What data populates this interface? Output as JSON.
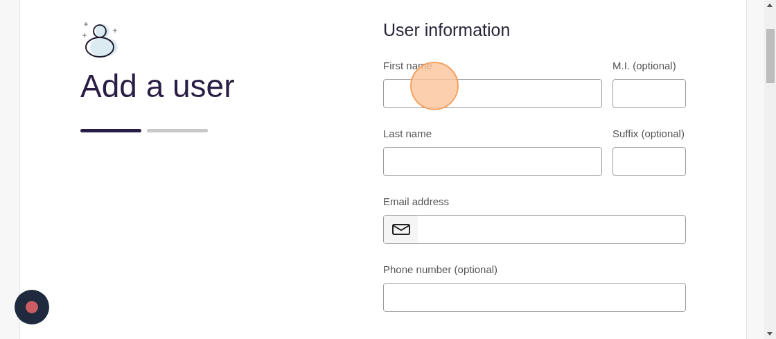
{
  "page": {
    "title": "Add a user"
  },
  "steps": [
    {
      "selected": true
    },
    {
      "selected": false
    }
  ],
  "form": {
    "title": "User information",
    "rows": [
      {
        "fields": [
          {
            "label": "First name",
            "kind": "text"
          },
          {
            "label": "M.I. (optional)",
            "kind": "text"
          }
        ]
      },
      {
        "fields": [
          {
            "label": "Last name",
            "kind": "text"
          },
          {
            "label": "Suffix (optional)",
            "kind": "text"
          }
        ]
      },
      {
        "fields": [
          {
            "label": "Email address",
            "kind": "email"
          }
        ]
      },
      {
        "fields": [
          {
            "label": "Phone number (optional)",
            "kind": "text"
          }
        ]
      }
    ]
  }
}
